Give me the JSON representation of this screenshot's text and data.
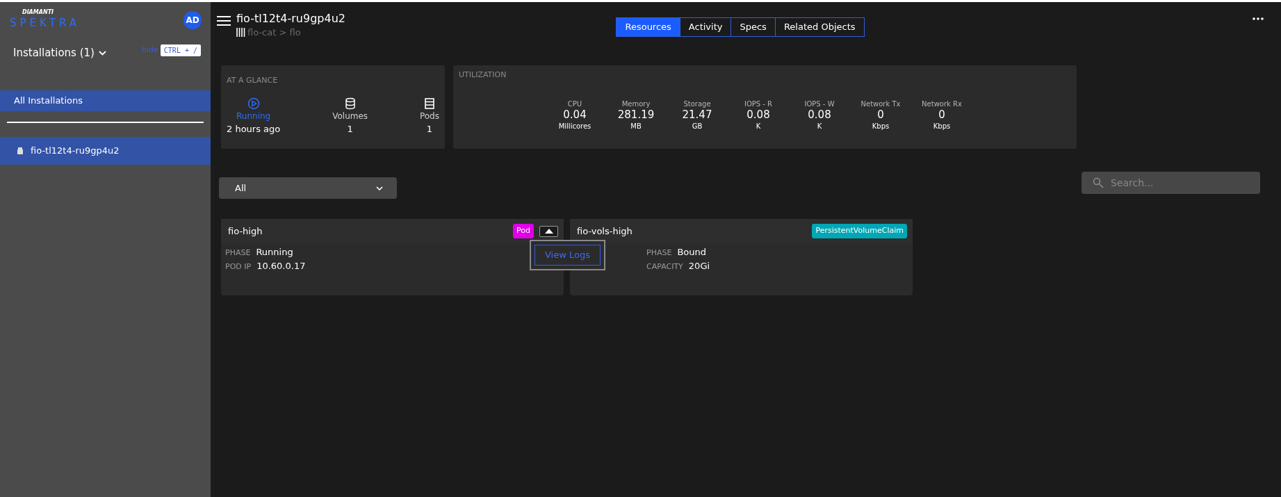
{
  "sidebar": {
    "brand": "DIAMANTI",
    "logo": "SPEKTRA",
    "avatar": "AD",
    "installations_title": "Installations (1)",
    "hide_link": "hide",
    "shortcut": "CTRL + /",
    "items": [
      {
        "label": "All Installations",
        "selected": true,
        "kind": "all"
      },
      {
        "label": "fio-tl12t4-ru9gp4u2",
        "selected": true,
        "kind": "installation"
      }
    ]
  },
  "header": {
    "title": "fio-tl12t4-ru9gp4u2",
    "breadcrumb": "flo-cat > flo",
    "tabs": [
      {
        "label": "Resources",
        "selected": true
      },
      {
        "label": "Activity",
        "selected": false
      },
      {
        "label": "Specs",
        "selected": false
      },
      {
        "label": "Related Objects",
        "selected": false
      }
    ]
  },
  "at_a_glance": {
    "title": "AT A GLANCE",
    "items": [
      {
        "kind": "running",
        "label": "Running",
        "value": "2 hours ago"
      },
      {
        "kind": "volumes",
        "label": "Volumes",
        "value": "1"
      },
      {
        "kind": "pods",
        "label": "Pods",
        "value": "1"
      }
    ]
  },
  "utilization": {
    "title": "UTILIZATION",
    "metrics": [
      {
        "label": "CPU",
        "value": "0.04",
        "unit": "Millicores"
      },
      {
        "label": "Memory",
        "value": "281.19",
        "unit": "MB"
      },
      {
        "label": "Storage",
        "value": "21.47",
        "unit": "GB"
      },
      {
        "label": "IOPS - R",
        "value": "0.08",
        "unit": "K"
      },
      {
        "label": "IOPS - W",
        "value": "0.08",
        "unit": "K"
      },
      {
        "label": "Network Tx",
        "value": "0",
        "unit": "Kbps"
      },
      {
        "label": "Network Rx",
        "value": "0",
        "unit": "Kbps"
      }
    ]
  },
  "filter": {
    "value": "All"
  },
  "search": {
    "placeholder": "Search..."
  },
  "cards": [
    {
      "title": "fio-high",
      "badge": "Pod",
      "color": "#e000e8",
      "menu_open": true,
      "fields": [
        {
          "label": "PHASE",
          "value": "Running"
        },
        {
          "label": "POD IP",
          "value": "10.60.0.17"
        }
      ]
    },
    {
      "title": "fio-vols-high",
      "badge": "PersistentVolumeClaim",
      "color": "#00a7b5",
      "menu_open": false,
      "fields": [
        {
          "label": "PHASE",
          "value": "Bound"
        },
        {
          "label": "CAPACITY",
          "value": "20Gi"
        }
      ]
    }
  ],
  "popup": {
    "action": "View Logs"
  }
}
